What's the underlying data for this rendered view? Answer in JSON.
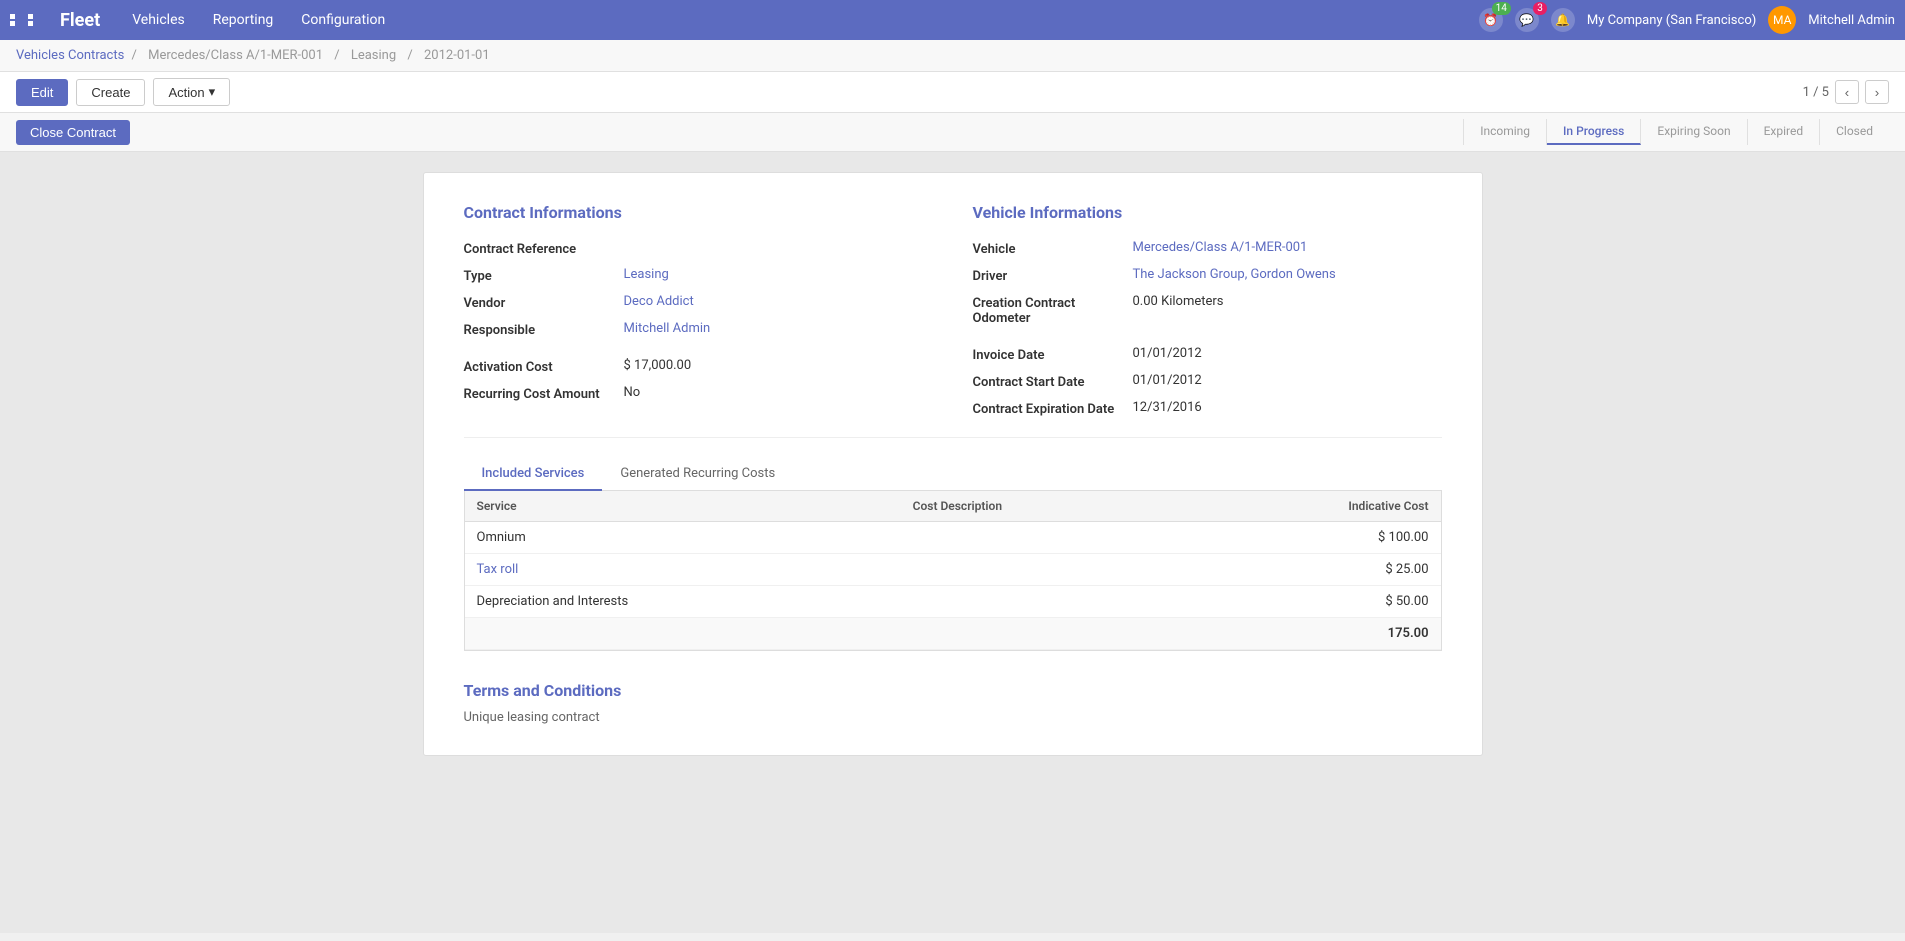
{
  "app": {
    "name": "Fleet",
    "grid_icon": "grid-icon"
  },
  "navbar": {
    "menu": [
      {
        "label": "Vehicles",
        "id": "vehicles"
      },
      {
        "label": "Reporting",
        "id": "reporting"
      },
      {
        "label": "Configuration",
        "id": "configuration"
      }
    ],
    "notifications_count": "14",
    "messages_count": "3",
    "company": "My Company (San Francisco)",
    "user": "Mitchell Admin"
  },
  "breadcrumb": {
    "parts": [
      {
        "label": "Vehicles Contracts",
        "link": true
      },
      {
        "label": "Mercedes/Class A/1-MER-001",
        "link": false
      },
      {
        "label": "Leasing",
        "link": false
      },
      {
        "label": "2012-01-01",
        "link": false
      }
    ]
  },
  "toolbar": {
    "edit_label": "Edit",
    "create_label": "Create",
    "action_label": "Action",
    "close_contract_label": "Close Contract",
    "pager": "1 / 5"
  },
  "status": {
    "items": [
      {
        "label": "Incoming",
        "active": false
      },
      {
        "label": "In Progress",
        "active": true
      },
      {
        "label": "Expiring Soon",
        "active": false
      },
      {
        "label": "Expired",
        "active": false
      },
      {
        "label": "Closed",
        "active": false
      }
    ]
  },
  "contract_info": {
    "title": "Contract Informations",
    "fields": [
      {
        "label": "Contract Reference",
        "value": ""
      },
      {
        "label": "Type",
        "value": "Leasing",
        "link": true
      },
      {
        "label": "Vendor",
        "value": "Deco Addict",
        "link": true
      },
      {
        "label": "Responsible",
        "value": "Mitchell Admin",
        "link": true
      }
    ],
    "cost_fields": [
      {
        "label": "Activation Cost",
        "value": "$ 17,000.00"
      },
      {
        "label": "Recurring Cost Amount",
        "value": "No"
      }
    ]
  },
  "vehicle_info": {
    "title": "Vehicle Informations",
    "fields": [
      {
        "label": "Vehicle",
        "value": "Mercedes/Class A/1-MER-001",
        "link": true
      },
      {
        "label": "Driver",
        "value": "The Jackson Group, Gordon Owens",
        "link": true
      },
      {
        "label": "Creation Contract Odometer",
        "value": "0.00 Kilometers",
        "link": false
      }
    ],
    "date_fields": [
      {
        "label": "Invoice Date",
        "value": "01/01/2012"
      },
      {
        "label": "Contract Start Date",
        "value": "01/01/2012"
      },
      {
        "label": "Contract Expiration Date",
        "value": "12/31/2016"
      }
    ]
  },
  "tabs": [
    {
      "label": "Included Services",
      "active": true
    },
    {
      "label": "Generated Recurring Costs",
      "active": false
    }
  ],
  "services_table": {
    "columns": [
      {
        "label": "Service",
        "align": "left"
      },
      {
        "label": "Cost Description",
        "align": "left"
      },
      {
        "label": "Indicative Cost",
        "align": "right"
      }
    ],
    "rows": [
      {
        "service": "Omnium",
        "service_link": true,
        "cost_description": "",
        "indicative_cost": "$ 100.00"
      },
      {
        "service": "Tax roll",
        "service_link": true,
        "cost_description": "",
        "indicative_cost": "$ 25.00"
      },
      {
        "service": "Depreciation and Interests",
        "service_link": false,
        "cost_description": "",
        "indicative_cost": "$ 50.00"
      }
    ],
    "total": "175.00"
  },
  "terms": {
    "title": "Terms and Conditions",
    "text": "Unique leasing contract"
  }
}
